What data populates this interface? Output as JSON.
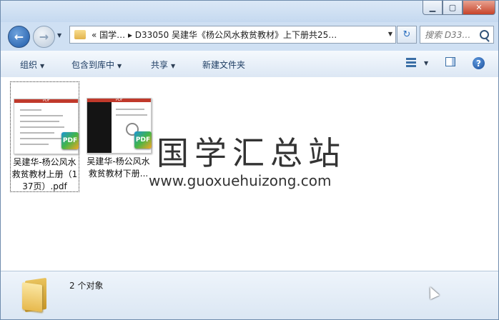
{
  "window": {
    "minimize_glyph": "▁",
    "maximize_glyph": "▢",
    "close_glyph": "✕"
  },
  "nav": {
    "back_glyph": "←",
    "forward_glyph": "→",
    "recent_glyph": "▼",
    "address_path": "«  国学…  ▸  D33050 吴建华《杨公风水救贫教材》上下册共25…",
    "address_drop_glyph": "▼",
    "refresh_glyph": "↻",
    "search_placeholder": "搜索 D33…"
  },
  "toolbar": {
    "organize": "组织",
    "include_in_library": "包含到库中",
    "share": "共享",
    "new_folder": "新建文件夹",
    "caret": "▼",
    "help_glyph": "?"
  },
  "files": [
    {
      "name": "吴建华-杨公风水救贫教材上册（137页）.pdf",
      "badge": "PDF",
      "thumb_header": "PDF",
      "selected": true
    },
    {
      "name": "吴建华-杨公风水救贫教材下册...",
      "badge": "PDF",
      "thumb_header": "PDF",
      "selected": false
    }
  ],
  "watermark": {
    "cn": "国学汇总站",
    "url": "www.guoxuehuizong.com"
  },
  "status": {
    "count_text": "2 个对象"
  },
  "icons": {
    "folder": "folder-icon",
    "pdf": "pdf-icon",
    "help": "help-icon",
    "search": "search-icon"
  },
  "colors": {
    "titlebar": "#c5d9f0",
    "close_button": "#c7442a",
    "pdf_header": "#c0392b",
    "content_bg": "#ffffff"
  }
}
